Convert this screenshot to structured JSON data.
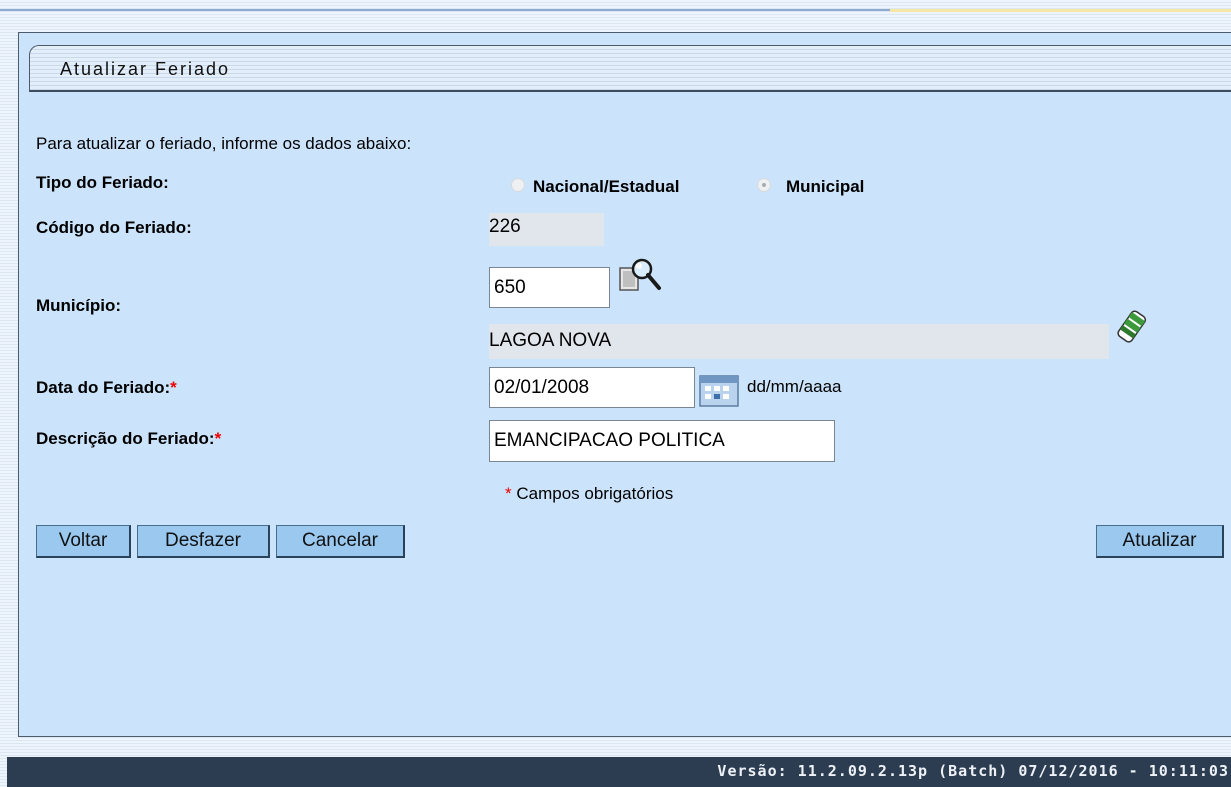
{
  "panel": {
    "title": "Atualizar Feriado"
  },
  "form": {
    "intro": "Para atualizar o feriado, informe os dados abaixo:",
    "tipo_label": "Tipo do Feriado:",
    "tipo_options": [
      "Nacional/Estadual",
      "Municipal"
    ],
    "tipo_selected": "Municipal",
    "codigo_label": "Código do Feriado:",
    "codigo_value": "226",
    "municipio_label": "Município:",
    "municipio_code": "650",
    "municipio_name": "LAGOA NOVA",
    "data_label": "Data do Feriado:",
    "data_value": "02/01/2008",
    "data_format": "dd/mm/aaaa",
    "descricao_label": "Descrição do Feriado:",
    "descricao_value": "EMANCIPACAO POLITICA",
    "required_marker": "*",
    "required_note": "Campos obrigatórios"
  },
  "buttons": {
    "voltar": "Voltar",
    "desfazer": "Desfazer",
    "cancelar": "Cancelar",
    "atualizar": "Atualizar"
  },
  "icons": {
    "search": "magnifier-icon",
    "clear": "eraser-icon",
    "calendar": "calendar-icon"
  },
  "footer": {
    "version": "Versão: 11.2.09.2.13p (Batch) 07/12/2016 - 10:11:03"
  }
}
